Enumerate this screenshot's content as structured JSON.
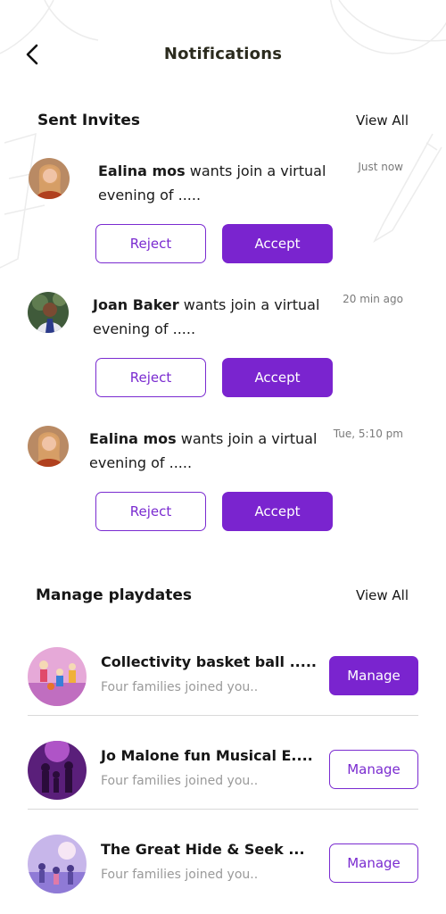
{
  "header": {
    "title": "Notifications"
  },
  "sent_invites": {
    "title": "Sent Invites",
    "view_all": "View All",
    "items": [
      {
        "name": "Ealina mos",
        "message": " wants join a virtual evening of .....",
        "time": "Just now",
        "reject_label": "Reject",
        "accept_label": "Accept"
      },
      {
        "name": "Joan Baker",
        "message": " wants join a virtual evening of .....",
        "time": "20 min ago",
        "reject_label": "Reject",
        "accept_label": "Accept"
      },
      {
        "name": "Ealina mos",
        "message": " wants join a virtual evening of .....",
        "time": "Tue, 5:10 pm",
        "reject_label": "Reject",
        "accept_label": "Accept"
      }
    ]
  },
  "manage_playdates": {
    "title": "Manage playdates",
    "view_all": "View All",
    "items": [
      {
        "title": "Collectivity basket ball .....",
        "subtitle": "Four families joined you..",
        "button": "Manage"
      },
      {
        "title": "Jo Malone fun Musical E....",
        "subtitle": "Four families joined you..",
        "button": "Manage"
      },
      {
        "title": "The Great Hide & Seek ...",
        "subtitle": "Four families joined you..",
        "button": "Manage"
      }
    ]
  },
  "colors": {
    "accent": "#7a24cf",
    "text": "#161616",
    "muted": "#9a9a9a",
    "divider": "#d9d9d9"
  }
}
